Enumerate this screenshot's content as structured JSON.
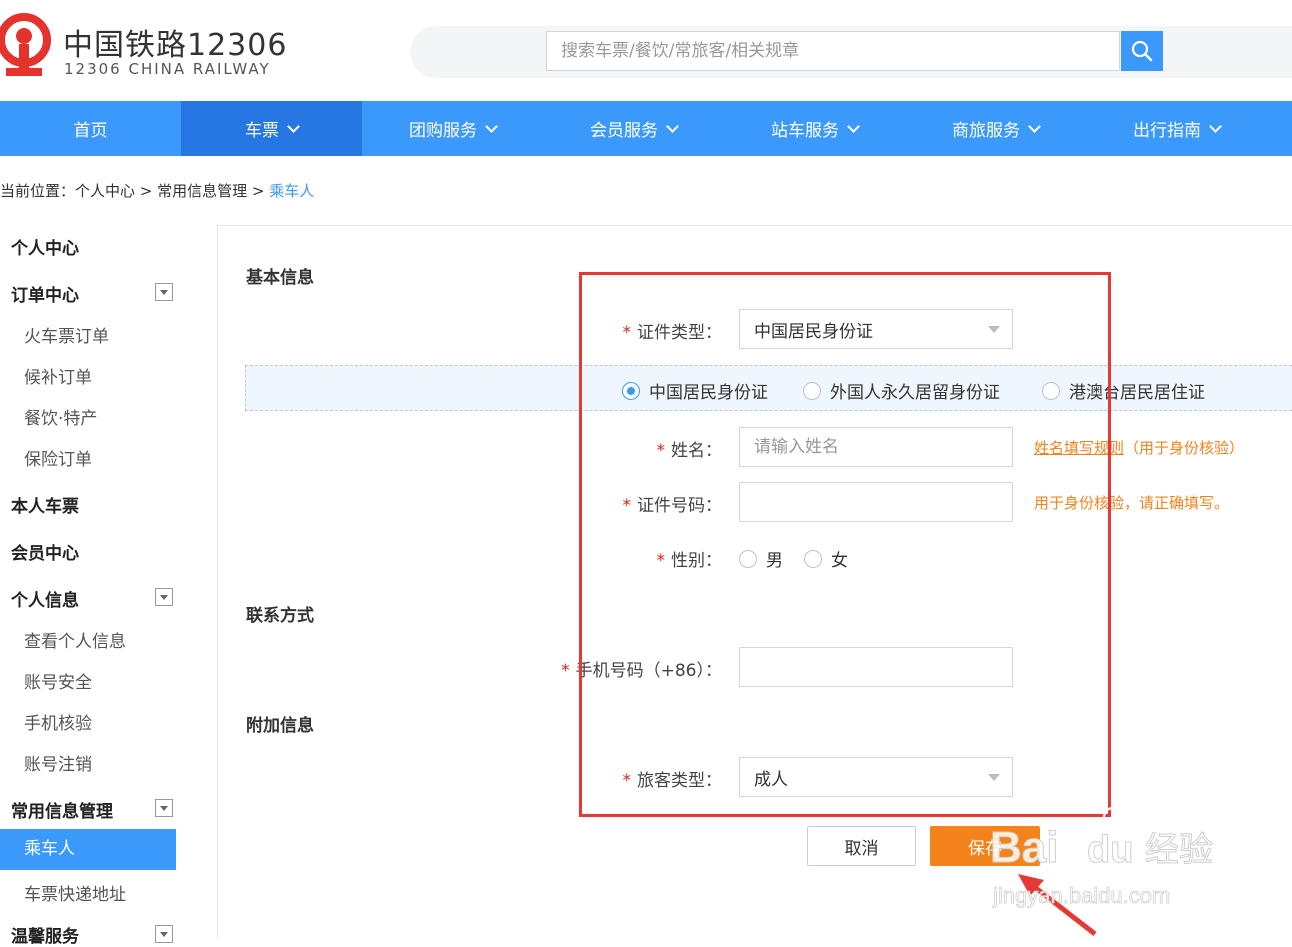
{
  "header": {
    "logo_cn": "中国铁路12306",
    "logo_en": "12306 CHINA RAILWAY",
    "search_placeholder": "搜索车票/餐饮/常旅客/相关规章"
  },
  "nav": [
    {
      "label": "首页",
      "dropdown": false,
      "active": false
    },
    {
      "label": "车票",
      "dropdown": true,
      "active": true
    },
    {
      "label": "团购服务",
      "dropdown": true,
      "active": false
    },
    {
      "label": "会员服务",
      "dropdown": true,
      "active": false
    },
    {
      "label": "站车服务",
      "dropdown": true,
      "active": false
    },
    {
      "label": "商旅服务",
      "dropdown": true,
      "active": false
    },
    {
      "label": "出行指南",
      "dropdown": true,
      "active": false
    }
  ],
  "breadcrumb": {
    "prefix": "当前位置：",
    "crumb1": "个人中心",
    "sep": " > ",
    "crumb2": "常用信息管理",
    "current": "乘车人"
  },
  "sidebar": {
    "personal_center": "个人中心",
    "order_center": "订单中心",
    "train_orders": "火车票订单",
    "waitlist_orders": "候补订单",
    "food_orders": "餐饮·特产",
    "insurance_orders": "保险订单",
    "my_tickets": "本人车票",
    "member_center": "会员中心",
    "personal_info": "个人信息",
    "view_info": "查看个人信息",
    "account_security": "账号安全",
    "phone_verify": "手机核验",
    "account_cancel": "账号注销",
    "common_info": "常用信息管理",
    "passengers": "乘车人",
    "delivery_address": "车票快递地址",
    "warm_service": "温馨服务"
  },
  "form": {
    "basic_info_title": "基本信息",
    "id_type_label": "证件类型：",
    "id_type_value": "中国居民身份证",
    "id_options": [
      "中国居民身份证",
      "外国人永久居留身份证",
      "港澳台居民居住证"
    ],
    "name_label": "姓名：",
    "name_placeholder": "请输入姓名",
    "name_hint_link": "姓名填写规则",
    "name_hint_text": "（用于身份核验）",
    "id_number_label": "证件号码：",
    "id_number_hint": "用于身份核验，请正确填写。",
    "gender_label": "性别：",
    "gender_male": "男",
    "gender_female": "女",
    "contact_title": "联系方式",
    "phone_label": "手机号码（+86）：",
    "extra_title": "附加信息",
    "passenger_type_label": "旅客类型：",
    "passenger_type_value": "成人",
    "cancel_label": "取消",
    "save_label": "保存",
    "required_mark": "*"
  },
  "watermark": {
    "brand": "Bai",
    "brand2": "du",
    "brand_cn": "经验",
    "url": "jingyan.baidu.com"
  },
  "colors": {
    "primary": "#3b99fc",
    "primary_dark": "#2676e3",
    "orange": "#f5831b",
    "annotation_red": "#e53935",
    "logo_red": "#e5322d"
  }
}
